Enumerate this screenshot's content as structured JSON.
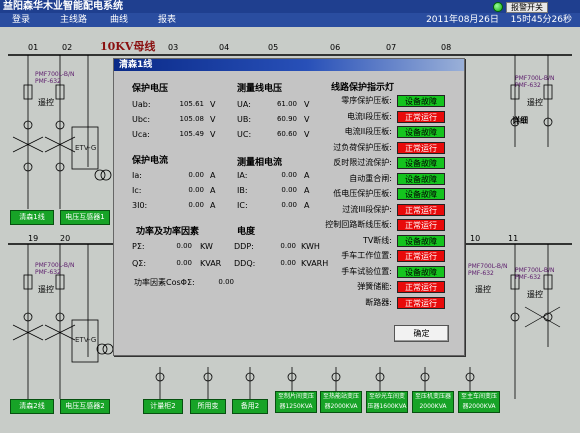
{
  "titlebar": {
    "title": "益阳森华木业智能配电系统",
    "alarm_button": "报警开关"
  },
  "menu": {
    "items": [
      "登录",
      "主线路",
      "曲线",
      "报表"
    ],
    "date": "2011年08月26日",
    "time": "15时45分26秒"
  },
  "background": {
    "bus_label": "10KV母线",
    "top_column_numbers": [
      "01",
      "02",
      "03",
      "04",
      "05",
      "06",
      "07",
      "08"
    ],
    "bottom_column_numbers": [
      "19",
      "20",
      "10",
      "11"
    ],
    "device_model_line1": "PMF700L-B/N",
    "device_model_line2": "PMF-632",
    "remote_label": "遥控",
    "detail_label": "详细",
    "etv_label": "ETV-G",
    "top_boxes": [
      "清森1线",
      "电压互感器1"
    ],
    "bottom_boxes": [
      "清森2线",
      "电压互感器2",
      "计量柜2",
      "所用变",
      "备用2",
      "至制片间变压器1250KVA",
      "至热能站变压器2000KVA",
      "至砂光车间变压器1600KVA",
      "至压机变压器2000KVA",
      "至主车间变压器2000KVA"
    ]
  },
  "modal": {
    "title": "清森1线",
    "protection_voltage": {
      "title": "保护电压",
      "rows": [
        {
          "label": "Uab:",
          "value": "105.61",
          "unit": "V"
        },
        {
          "label": "Ubc:",
          "value": "105.08",
          "unit": "V"
        },
        {
          "label": "Uca:",
          "value": "105.49",
          "unit": "V"
        }
      ]
    },
    "line_voltage": {
      "title": "测量线电压",
      "rows": [
        {
          "label": "UA:",
          "value": "61.00",
          "unit": "V"
        },
        {
          "label": "UB:",
          "value": "60.90",
          "unit": "V"
        },
        {
          "label": "UC:",
          "value": "60.60",
          "unit": "V"
        }
      ]
    },
    "protection_current": {
      "title": "保护电流",
      "rows": [
        {
          "label": "Ia:",
          "value": "0.00",
          "unit": "A"
        },
        {
          "label": "Ic:",
          "value": "0.00",
          "unit": "A"
        },
        {
          "label": "3I0:",
          "value": "0.00",
          "unit": "A"
        }
      ]
    },
    "phase_current": {
      "title": "测量相电流",
      "rows": [
        {
          "label": "IA:",
          "value": "0.00",
          "unit": "A"
        },
        {
          "label": "IB:",
          "value": "0.00",
          "unit": "A"
        },
        {
          "label": "IC:",
          "value": "0.00",
          "unit": "A"
        }
      ]
    },
    "power": {
      "title": "功率及功率因素",
      "rows": [
        {
          "label": "PΣ:",
          "value": "0.00",
          "unit": "KW"
        },
        {
          "label": "QΣ:",
          "value": "0.00",
          "unit": "KVAR"
        }
      ],
      "pf_label": "功率因素CosΦΣ:",
      "pf_value": "0.00"
    },
    "energy": {
      "title": "电度",
      "rows": [
        {
          "label": "DDP:",
          "value": "0.00",
          "unit": "KWH"
        },
        {
          "label": "DDQ:",
          "value": "0.00",
          "unit": "KVARH"
        }
      ]
    },
    "protection_lights": {
      "title": "线路保护指示灯",
      "items": [
        {
          "name": "零序保护压板:",
          "status": "设备故障",
          "kind": "fault"
        },
        {
          "name": "电流I段压板:",
          "status": "正常运行",
          "kind": "run"
        },
        {
          "name": "电流II段压板:",
          "status": "设备故障",
          "kind": "fault"
        },
        {
          "name": "过负荷保护压板:",
          "status": "正常运行",
          "kind": "run"
        },
        {
          "name": "反时限过流保护:",
          "status": "设备故障",
          "kind": "fault"
        },
        {
          "name": "自动重合闸:",
          "status": "设备故障",
          "kind": "fault"
        },
        {
          "name": "低电压保护压板:",
          "status": "设备故障",
          "kind": "fault"
        },
        {
          "name": "过流III段保护:",
          "status": "正常运行",
          "kind": "run"
        },
        {
          "name": "控制回路断线压板:",
          "status": "正常运行",
          "kind": "run"
        },
        {
          "name": "TV断线:",
          "status": "设备故障",
          "kind": "fault"
        },
        {
          "name": "手车工作位置:",
          "status": "正常运行",
          "kind": "run"
        },
        {
          "name": "手车试验位置:",
          "status": "设备故障",
          "kind": "fault"
        },
        {
          "name": "弹簧储能:",
          "status": "正常运行",
          "kind": "run"
        },
        {
          "name": "断路器:",
          "status": "正常运行",
          "kind": "run"
        }
      ]
    },
    "ok_button": "确定"
  },
  "colors": {
    "titlebar": "#1f3f8f",
    "status_fault": "#14c41e",
    "status_run": "#e80a0a",
    "panel_box": "#17a327"
  }
}
